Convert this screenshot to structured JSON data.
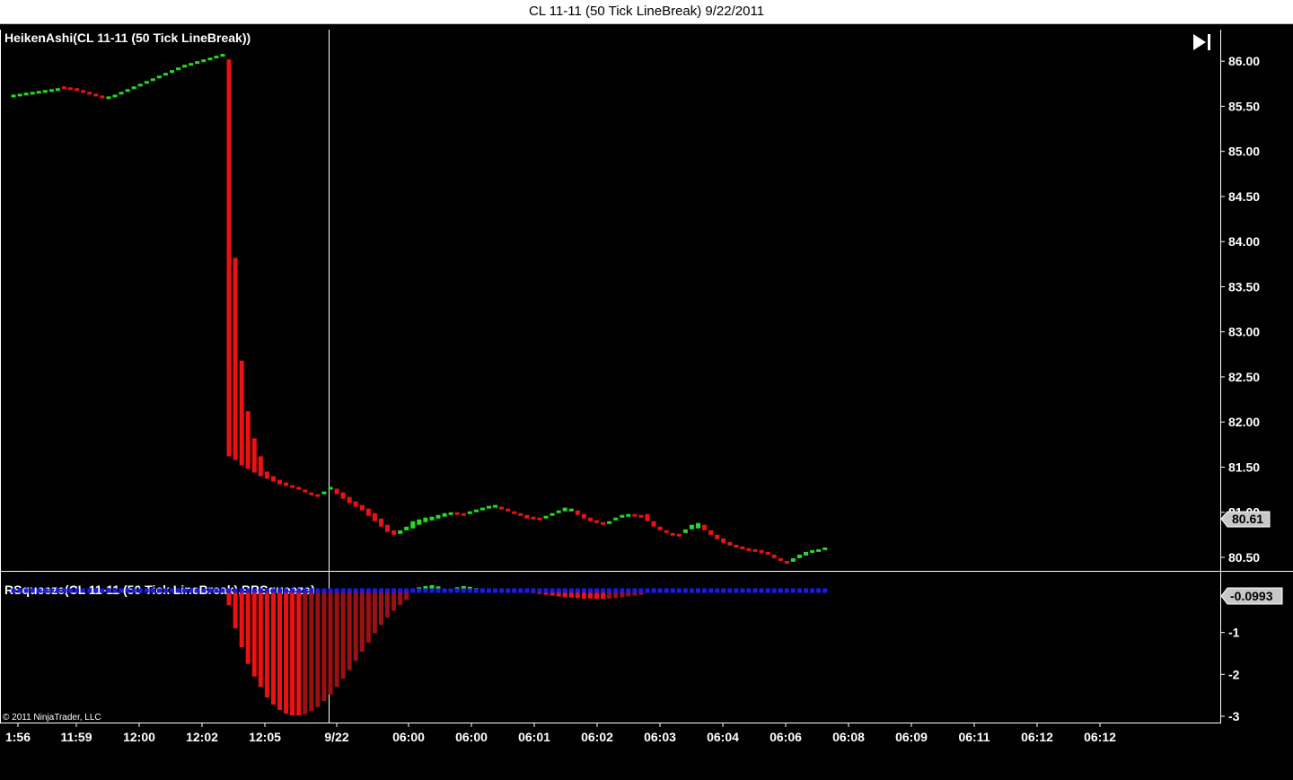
{
  "window": {
    "title": "CL 11-11 (50 Tick LineBreak)  9/22/2011"
  },
  "colors": {
    "background": "#000000",
    "up": "#22dd22",
    "down": "#ee1111",
    "dark_down": "#991111",
    "squeeze": "#1a1aee",
    "axis": "#ffffff"
  },
  "copyright": "© 2011 NinjaTrader, LLC",
  "controls": {
    "scroll_end_icon": "skip-to-end-icon"
  },
  "chart_data": [
    {
      "type": "bar",
      "name": "price-panel",
      "title": "HeikenAshi(CL 11-11 (50 Tick LineBreak))",
      "ylim": [
        80.35,
        86.35
      ],
      "yticks": [
        "86.00",
        "85.50",
        "85.00",
        "84.50",
        "84.00",
        "83.50",
        "83.00",
        "82.50",
        "82.00",
        "81.50",
        "81.00",
        "80.50"
      ],
      "last_price_label": "80.61",
      "bars": [
        {
          "o": 85.62,
          "c": 85.63,
          "col": "up"
        },
        {
          "o": 85.63,
          "c": 85.64,
          "col": "up"
        },
        {
          "o": 85.64,
          "c": 85.65,
          "col": "up"
        },
        {
          "o": 85.65,
          "c": 85.66,
          "col": "up"
        },
        {
          "o": 85.66,
          "c": 85.67,
          "col": "up"
        },
        {
          "o": 85.67,
          "c": 85.68,
          "col": "up"
        },
        {
          "o": 85.68,
          "c": 85.69,
          "col": "up"
        },
        {
          "o": 85.69,
          "c": 85.7,
          "col": "up"
        },
        {
          "o": 85.72,
          "c": 85.71,
          "col": "down"
        },
        {
          "o": 85.71,
          "c": 85.7,
          "col": "down"
        },
        {
          "o": 85.7,
          "c": 85.68,
          "col": "down"
        },
        {
          "o": 85.68,
          "c": 85.66,
          "col": "down"
        },
        {
          "o": 85.66,
          "c": 85.64,
          "col": "down"
        },
        {
          "o": 85.64,
          "c": 85.62,
          "col": "down"
        },
        {
          "o": 85.62,
          "c": 85.6,
          "col": "down"
        },
        {
          "o": 85.6,
          "c": 85.61,
          "col": "up"
        },
        {
          "o": 85.61,
          "c": 85.63,
          "col": "up"
        },
        {
          "o": 85.63,
          "c": 85.66,
          "col": "up"
        },
        {
          "o": 85.66,
          "c": 85.69,
          "col": "up"
        },
        {
          "o": 85.69,
          "c": 85.72,
          "col": "up"
        },
        {
          "o": 85.72,
          "c": 85.75,
          "col": "up"
        },
        {
          "o": 85.75,
          "c": 85.78,
          "col": "up"
        },
        {
          "o": 85.78,
          "c": 85.81,
          "col": "up"
        },
        {
          "o": 85.81,
          "c": 85.84,
          "col": "up"
        },
        {
          "o": 85.84,
          "c": 85.87,
          "col": "up"
        },
        {
          "o": 85.87,
          "c": 85.9,
          "col": "up"
        },
        {
          "o": 85.9,
          "c": 85.93,
          "col": "up"
        },
        {
          "o": 85.93,
          "c": 85.96,
          "col": "up"
        },
        {
          "o": 85.96,
          "c": 85.98,
          "col": "up"
        },
        {
          "o": 85.98,
          "c": 86.0,
          "col": "up"
        },
        {
          "o": 86.0,
          "c": 86.02,
          "col": "up"
        },
        {
          "o": 86.02,
          "c": 86.04,
          "col": "up"
        },
        {
          "o": 86.04,
          "c": 86.06,
          "col": "up"
        },
        {
          "o": 86.06,
          "c": 86.08,
          "col": "up"
        },
        {
          "o": 86.02,
          "c": 81.62,
          "col": "down"
        },
        {
          "o": 83.82,
          "c": 81.58,
          "col": "down"
        },
        {
          "o": 82.68,
          "c": 81.52,
          "col": "down"
        },
        {
          "o": 82.12,
          "c": 81.48,
          "col": "down"
        },
        {
          "o": 81.82,
          "c": 81.44,
          "col": "down"
        },
        {
          "o": 81.62,
          "c": 81.4,
          "col": "down"
        },
        {
          "o": 81.45,
          "c": 81.37,
          "col": "down"
        },
        {
          "o": 81.4,
          "c": 81.34,
          "col": "down"
        },
        {
          "o": 81.36,
          "c": 81.31,
          "col": "down"
        },
        {
          "o": 81.33,
          "c": 81.29,
          "col": "down"
        },
        {
          "o": 81.3,
          "c": 81.27,
          "col": "down"
        },
        {
          "o": 81.28,
          "c": 81.25,
          "col": "down"
        },
        {
          "o": 81.25,
          "c": 81.22,
          "col": "down"
        },
        {
          "o": 81.22,
          "c": 81.2,
          "col": "down"
        },
        {
          "o": 81.2,
          "c": 81.18,
          "col": "down"
        },
        {
          "o": 81.2,
          "c": 81.23,
          "col": "up"
        },
        {
          "o": 81.25,
          "c": 81.28,
          "col": "up"
        },
        {
          "o": 81.26,
          "c": 81.2,
          "col": "down"
        },
        {
          "o": 81.22,
          "c": 81.15,
          "col": "down"
        },
        {
          "o": 81.17,
          "c": 81.1,
          "col": "down"
        },
        {
          "o": 81.12,
          "c": 81.06,
          "col": "down"
        },
        {
          "o": 81.08,
          "c": 81.02,
          "col": "down"
        },
        {
          "o": 81.04,
          "c": 80.96,
          "col": "down"
        },
        {
          "o": 80.99,
          "c": 80.9,
          "col": "down"
        },
        {
          "o": 80.93,
          "c": 80.84,
          "col": "down"
        },
        {
          "o": 80.86,
          "c": 80.78,
          "col": "down"
        },
        {
          "o": 80.8,
          "c": 80.75,
          "col": "down"
        },
        {
          "o": 80.76,
          "c": 80.8,
          "col": "up"
        },
        {
          "o": 80.8,
          "c": 80.84,
          "col": "up"
        },
        {
          "o": 80.82,
          "c": 80.9,
          "col": "up"
        },
        {
          "o": 80.86,
          "c": 80.92,
          "col": "up"
        },
        {
          "o": 80.89,
          "c": 80.94,
          "col": "up"
        },
        {
          "o": 80.91,
          "c": 80.95,
          "col": "up"
        },
        {
          "o": 80.93,
          "c": 80.97,
          "col": "up"
        },
        {
          "o": 80.95,
          "c": 80.99,
          "col": "up"
        },
        {
          "o": 80.97,
          "c": 81.0,
          "col": "up"
        },
        {
          "o": 81.0,
          "c": 80.98,
          "col": "down"
        },
        {
          "o": 80.99,
          "c": 80.97,
          "col": "down"
        },
        {
          "o": 80.98,
          "c": 81.01,
          "col": "up"
        },
        {
          "o": 81.01,
          "c": 81.03,
          "col": "up"
        },
        {
          "o": 81.03,
          "c": 81.05,
          "col": "up"
        },
        {
          "o": 81.05,
          "c": 81.07,
          "col": "up"
        },
        {
          "o": 81.07,
          "c": 81.08,
          "col": "up"
        },
        {
          "o": 81.06,
          "c": 81.04,
          "col": "down"
        },
        {
          "o": 81.04,
          "c": 81.01,
          "col": "down"
        },
        {
          "o": 81.01,
          "c": 80.98,
          "col": "down"
        },
        {
          "o": 80.99,
          "c": 80.96,
          "col": "down"
        },
        {
          "o": 80.97,
          "c": 80.93,
          "col": "down"
        },
        {
          "o": 80.95,
          "c": 80.92,
          "col": "down"
        },
        {
          "o": 80.94,
          "c": 80.91,
          "col": "down"
        },
        {
          "o": 80.93,
          "c": 80.96,
          "col": "up"
        },
        {
          "o": 80.96,
          "c": 80.99,
          "col": "up"
        },
        {
          "o": 80.99,
          "c": 81.02,
          "col": "up"
        },
        {
          "o": 81.01,
          "c": 81.05,
          "col": "up"
        },
        {
          "o": 81.03,
          "c": 81.04,
          "col": "up"
        },
        {
          "o": 81.02,
          "c": 80.97,
          "col": "down"
        },
        {
          "o": 80.98,
          "c": 80.93,
          "col": "down"
        },
        {
          "o": 80.94,
          "c": 80.9,
          "col": "down"
        },
        {
          "o": 80.91,
          "c": 80.88,
          "col": "down"
        },
        {
          "o": 80.89,
          "c": 80.87,
          "col": "down"
        },
        {
          "o": 80.88,
          "c": 80.9,
          "col": "up"
        },
        {
          "o": 80.91,
          "c": 80.94,
          "col": "up"
        },
        {
          "o": 80.94,
          "c": 80.97,
          "col": "up"
        },
        {
          "o": 80.96,
          "c": 80.98,
          "col": "up"
        },
        {
          "o": 80.98,
          "c": 80.97,
          "col": "down"
        },
        {
          "o": 80.97,
          "c": 80.96,
          "col": "down"
        },
        {
          "o": 80.98,
          "c": 80.9,
          "col": "down"
        },
        {
          "o": 80.9,
          "c": 80.84,
          "col": "down"
        },
        {
          "o": 80.84,
          "c": 80.8,
          "col": "down"
        },
        {
          "o": 80.8,
          "c": 80.77,
          "col": "down"
        },
        {
          "o": 80.77,
          "c": 80.75,
          "col": "down"
        },
        {
          "o": 80.76,
          "c": 80.74,
          "col": "down"
        },
        {
          "o": 80.77,
          "c": 80.81,
          "col": "up"
        },
        {
          "o": 80.81,
          "c": 80.86,
          "col": "up"
        },
        {
          "o": 80.82,
          "c": 80.88,
          "col": "up"
        },
        {
          "o": 80.86,
          "c": 80.8,
          "col": "down"
        },
        {
          "o": 80.8,
          "c": 80.75,
          "col": "down"
        },
        {
          "o": 80.75,
          "c": 80.7,
          "col": "down"
        },
        {
          "o": 80.71,
          "c": 80.66,
          "col": "down"
        },
        {
          "o": 80.67,
          "c": 80.63,
          "col": "down"
        },
        {
          "o": 80.64,
          "c": 80.61,
          "col": "down"
        },
        {
          "o": 80.62,
          "c": 80.59,
          "col": "down"
        },
        {
          "o": 80.6,
          "c": 80.58,
          "col": "down"
        },
        {
          "o": 80.59,
          "c": 80.57,
          "col": "down"
        },
        {
          "o": 80.58,
          "c": 80.56,
          "col": "down"
        },
        {
          "o": 80.56,
          "c": 80.53,
          "col": "down"
        },
        {
          "o": 80.53,
          "c": 80.49,
          "col": "down"
        },
        {
          "o": 80.49,
          "c": 80.46,
          "col": "down"
        },
        {
          "o": 80.46,
          "c": 80.44,
          "col": "down"
        },
        {
          "o": 80.45,
          "c": 80.49,
          "col": "up"
        },
        {
          "o": 80.49,
          "c": 80.53,
          "col": "up"
        },
        {
          "o": 80.52,
          "c": 80.56,
          "col": "up"
        },
        {
          "o": 80.55,
          "c": 80.58,
          "col": "up"
        },
        {
          "o": 80.57,
          "c": 80.59,
          "col": "up"
        },
        {
          "o": 80.59,
          "c": 80.61,
          "col": "up"
        }
      ]
    },
    {
      "type": "bar",
      "name": "squeeze-panel",
      "title": "RSqueeze(CL 11-11 (50 Tick LineBreak),BBSqueeze)",
      "ylim": [
        -3.15,
        0.45
      ],
      "yticks": [
        "-1",
        "-2",
        "-3"
      ],
      "last_value_label": "-0.0993",
      "histogram_start": 34,
      "histogram": [
        -0.35,
        -0.9,
        -1.35,
        -1.75,
        -2.05,
        -2.3,
        -2.55,
        -2.72,
        -2.85,
        -2.94,
        -2.98,
        -2.98,
        -2.95,
        -2.88,
        -2.78,
        -2.64,
        -2.48,
        -2.3,
        -2.1,
        -1.9,
        -1.68,
        -1.46,
        -1.24,
        -1.02,
        -0.82,
        -0.64,
        -0.48,
        -0.34,
        -0.22,
        0.04,
        0.08,
        0.11,
        0.13,
        0.1,
        0.05,
        0.04,
        0.08,
        0.11,
        0.09,
        0.06,
        0.03,
        0.02,
        0.01,
        0.0,
        -0.01,
        -0.02,
        -0.03,
        -0.04,
        -0.06,
        -0.08,
        -0.1,
        -0.12,
        -0.14,
        -0.16,
        -0.17,
        -0.18,
        -0.19,
        -0.19,
        -0.2,
        -0.2,
        -0.19,
        -0.18,
        -0.16,
        -0.14,
        -0.12,
        -0.1
      ]
    }
  ],
  "x_axis": {
    "labels": [
      "1:56",
      "11:59",
      "12:00",
      "12:02",
      "12:05",
      "9/22",
      "06:00",
      "06:00",
      "06:01",
      "06:02",
      "06:03",
      "06:04",
      "06:06",
      "06:08",
      "06:09",
      "06:11",
      "06:12",
      "06:12"
    ]
  }
}
